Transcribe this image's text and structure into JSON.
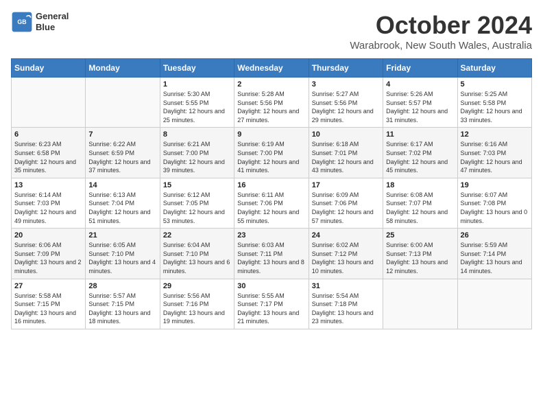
{
  "header": {
    "logo_line1": "General",
    "logo_line2": "Blue",
    "month": "October 2024",
    "location": "Warabrook, New South Wales, Australia"
  },
  "days_of_week": [
    "Sunday",
    "Monday",
    "Tuesday",
    "Wednesday",
    "Thursday",
    "Friday",
    "Saturday"
  ],
  "weeks": [
    [
      {
        "day": "",
        "sunrise": "",
        "sunset": "",
        "daylight": ""
      },
      {
        "day": "",
        "sunrise": "",
        "sunset": "",
        "daylight": ""
      },
      {
        "day": "1",
        "sunrise": "Sunrise: 5:30 AM",
        "sunset": "Sunset: 5:55 PM",
        "daylight": "Daylight: 12 hours and 25 minutes."
      },
      {
        "day": "2",
        "sunrise": "Sunrise: 5:28 AM",
        "sunset": "Sunset: 5:56 PM",
        "daylight": "Daylight: 12 hours and 27 minutes."
      },
      {
        "day": "3",
        "sunrise": "Sunrise: 5:27 AM",
        "sunset": "Sunset: 5:56 PM",
        "daylight": "Daylight: 12 hours and 29 minutes."
      },
      {
        "day": "4",
        "sunrise": "Sunrise: 5:26 AM",
        "sunset": "Sunset: 5:57 PM",
        "daylight": "Daylight: 12 hours and 31 minutes."
      },
      {
        "day": "5",
        "sunrise": "Sunrise: 5:25 AM",
        "sunset": "Sunset: 5:58 PM",
        "daylight": "Daylight: 12 hours and 33 minutes."
      }
    ],
    [
      {
        "day": "6",
        "sunrise": "Sunrise: 6:23 AM",
        "sunset": "Sunset: 6:58 PM",
        "daylight": "Daylight: 12 hours and 35 minutes."
      },
      {
        "day": "7",
        "sunrise": "Sunrise: 6:22 AM",
        "sunset": "Sunset: 6:59 PM",
        "daylight": "Daylight: 12 hours and 37 minutes."
      },
      {
        "day": "8",
        "sunrise": "Sunrise: 6:21 AM",
        "sunset": "Sunset: 7:00 PM",
        "daylight": "Daylight: 12 hours and 39 minutes."
      },
      {
        "day": "9",
        "sunrise": "Sunrise: 6:19 AM",
        "sunset": "Sunset: 7:00 PM",
        "daylight": "Daylight: 12 hours and 41 minutes."
      },
      {
        "day": "10",
        "sunrise": "Sunrise: 6:18 AM",
        "sunset": "Sunset: 7:01 PM",
        "daylight": "Daylight: 12 hours and 43 minutes."
      },
      {
        "day": "11",
        "sunrise": "Sunrise: 6:17 AM",
        "sunset": "Sunset: 7:02 PM",
        "daylight": "Daylight: 12 hours and 45 minutes."
      },
      {
        "day": "12",
        "sunrise": "Sunrise: 6:16 AM",
        "sunset": "Sunset: 7:03 PM",
        "daylight": "Daylight: 12 hours and 47 minutes."
      }
    ],
    [
      {
        "day": "13",
        "sunrise": "Sunrise: 6:14 AM",
        "sunset": "Sunset: 7:03 PM",
        "daylight": "Daylight: 12 hours and 49 minutes."
      },
      {
        "day": "14",
        "sunrise": "Sunrise: 6:13 AM",
        "sunset": "Sunset: 7:04 PM",
        "daylight": "Daylight: 12 hours and 51 minutes."
      },
      {
        "day": "15",
        "sunrise": "Sunrise: 6:12 AM",
        "sunset": "Sunset: 7:05 PM",
        "daylight": "Daylight: 12 hours and 53 minutes."
      },
      {
        "day": "16",
        "sunrise": "Sunrise: 6:11 AM",
        "sunset": "Sunset: 7:06 PM",
        "daylight": "Daylight: 12 hours and 55 minutes."
      },
      {
        "day": "17",
        "sunrise": "Sunrise: 6:09 AM",
        "sunset": "Sunset: 7:06 PM",
        "daylight": "Daylight: 12 hours and 57 minutes."
      },
      {
        "day": "18",
        "sunrise": "Sunrise: 6:08 AM",
        "sunset": "Sunset: 7:07 PM",
        "daylight": "Daylight: 12 hours and 58 minutes."
      },
      {
        "day": "19",
        "sunrise": "Sunrise: 6:07 AM",
        "sunset": "Sunset: 7:08 PM",
        "daylight": "Daylight: 13 hours and 0 minutes."
      }
    ],
    [
      {
        "day": "20",
        "sunrise": "Sunrise: 6:06 AM",
        "sunset": "Sunset: 7:09 PM",
        "daylight": "Daylight: 13 hours and 2 minutes."
      },
      {
        "day": "21",
        "sunrise": "Sunrise: 6:05 AM",
        "sunset": "Sunset: 7:10 PM",
        "daylight": "Daylight: 13 hours and 4 minutes."
      },
      {
        "day": "22",
        "sunrise": "Sunrise: 6:04 AM",
        "sunset": "Sunset: 7:10 PM",
        "daylight": "Daylight: 13 hours and 6 minutes."
      },
      {
        "day": "23",
        "sunrise": "Sunrise: 6:03 AM",
        "sunset": "Sunset: 7:11 PM",
        "daylight": "Daylight: 13 hours and 8 minutes."
      },
      {
        "day": "24",
        "sunrise": "Sunrise: 6:02 AM",
        "sunset": "Sunset: 7:12 PM",
        "daylight": "Daylight: 13 hours and 10 minutes."
      },
      {
        "day": "25",
        "sunrise": "Sunrise: 6:00 AM",
        "sunset": "Sunset: 7:13 PM",
        "daylight": "Daylight: 13 hours and 12 minutes."
      },
      {
        "day": "26",
        "sunrise": "Sunrise: 5:59 AM",
        "sunset": "Sunset: 7:14 PM",
        "daylight": "Daylight: 13 hours and 14 minutes."
      }
    ],
    [
      {
        "day": "27",
        "sunrise": "Sunrise: 5:58 AM",
        "sunset": "Sunset: 7:15 PM",
        "daylight": "Daylight: 13 hours and 16 minutes."
      },
      {
        "day": "28",
        "sunrise": "Sunrise: 5:57 AM",
        "sunset": "Sunset: 7:15 PM",
        "daylight": "Daylight: 13 hours and 18 minutes."
      },
      {
        "day": "29",
        "sunrise": "Sunrise: 5:56 AM",
        "sunset": "Sunset: 7:16 PM",
        "daylight": "Daylight: 13 hours and 19 minutes."
      },
      {
        "day": "30",
        "sunrise": "Sunrise: 5:55 AM",
        "sunset": "Sunset: 7:17 PM",
        "daylight": "Daylight: 13 hours and 21 minutes."
      },
      {
        "day": "31",
        "sunrise": "Sunrise: 5:54 AM",
        "sunset": "Sunset: 7:18 PM",
        "daylight": "Daylight: 13 hours and 23 minutes."
      },
      {
        "day": "",
        "sunrise": "",
        "sunset": "",
        "daylight": ""
      },
      {
        "day": "",
        "sunrise": "",
        "sunset": "",
        "daylight": ""
      }
    ]
  ]
}
